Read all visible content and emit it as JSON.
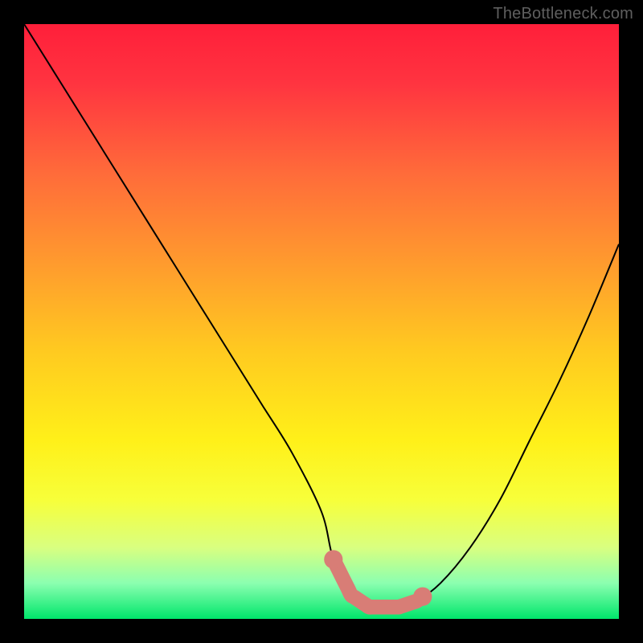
{
  "watermark": "TheBottleneck.com",
  "chart_data": {
    "type": "line",
    "title": "",
    "xlabel": "",
    "ylabel": "",
    "xlim": [
      0,
      100
    ],
    "ylim": [
      0,
      100
    ],
    "series": [
      {
        "name": "curve",
        "x": [
          0,
          5,
          10,
          15,
          20,
          25,
          30,
          35,
          40,
          45,
          50,
          52,
          55,
          58,
          60,
          63,
          66,
          70,
          75,
          80,
          85,
          90,
          95,
          100
        ],
        "y": [
          100,
          92,
          84,
          76,
          68,
          60,
          52,
          44,
          36,
          28,
          18,
          10,
          4,
          2,
          2,
          2,
          3,
          6,
          12,
          20,
          30,
          40,
          51,
          63
        ]
      }
    ],
    "pink_band": {
      "x_start": 52,
      "x_end": 67,
      "thickness": 2.5,
      "color": "#d87d76"
    },
    "gradient_stops": [
      {
        "pos": 0.0,
        "color": "#ff1f3a"
      },
      {
        "pos": 0.1,
        "color": "#ff3440"
      },
      {
        "pos": 0.25,
        "color": "#ff6b3a"
      },
      {
        "pos": 0.4,
        "color": "#ff9a2e"
      },
      {
        "pos": 0.55,
        "color": "#ffca20"
      },
      {
        "pos": 0.7,
        "color": "#fff019"
      },
      {
        "pos": 0.8,
        "color": "#f7ff3a"
      },
      {
        "pos": 0.88,
        "color": "#d9ff80"
      },
      {
        "pos": 0.94,
        "color": "#8bffb0"
      },
      {
        "pos": 1.0,
        "color": "#00e66b"
      }
    ]
  }
}
